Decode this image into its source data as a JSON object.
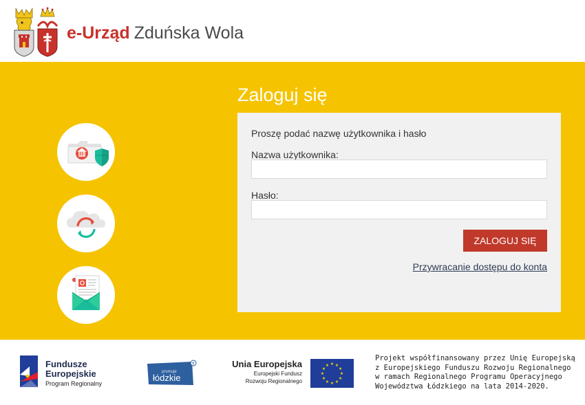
{
  "header": {
    "brand_name": "e-Urząd",
    "city_name": "Zduńska Wola",
    "crest_icons": [
      "lion-crest-icon",
      "cross-crest-icon"
    ]
  },
  "colors": {
    "accent_yellow": "#f5c300",
    "brand_red": "#c8322b",
    "button_red": "#c0392b",
    "panel_gray": "#f1f1f1",
    "link_navy": "#2f3b55"
  },
  "features": {
    "icons": [
      "secure-folder-icon",
      "cloud-sync-icon",
      "envelope-document-icon"
    ]
  },
  "login": {
    "title": "Zaloguj się",
    "prompt": "Proszę podać nazwę użytkownika i hasło",
    "username_label": "Nazwa użytkownika:",
    "username_value": "",
    "password_label": "Hasło:",
    "password_value": "",
    "submit_label": "ZALOGUJ SIĘ",
    "recover_link": "Przywracanie dostępu do konta"
  },
  "footer": {
    "fe_line1": "Fundusze",
    "fe_line2": "Europejskie",
    "fe_line3": "Program Regionalny",
    "lodz_small": "promuje",
    "lodz_big": "łódzkie",
    "ue_title": "Unia Europejska",
    "ue_line1": "Europejski Fundusz",
    "ue_line2": "Rozwoju Regionalnego",
    "project_lines": [
      "Projekt współfinansowany przez Unię Europejską",
      "z Europejskiego Funduszu Rozwoju Regionalnego",
      "w ramach Regionalnego Programu Operacyjnego",
      "Województwa Łódzkiego na lata 2014-2020."
    ]
  }
}
